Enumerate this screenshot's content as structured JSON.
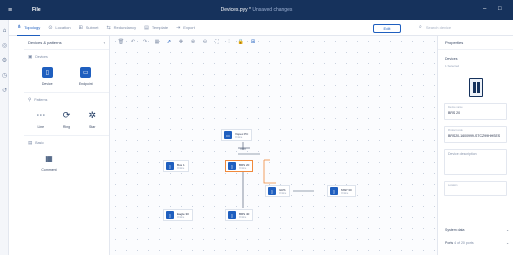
{
  "titlebar": {
    "file_label": "File",
    "doc_name": "Devices.pyy *",
    "doc_status": "Unsaved changes",
    "minimize": "–",
    "maximize": "□"
  },
  "tabs": [
    {
      "label": "Topology",
      "icon": "topology-icon"
    },
    {
      "label": "Location",
      "icon": "location-icon"
    },
    {
      "label": "Subnet",
      "icon": "subnet-icon"
    },
    {
      "label": "Redundancy",
      "icon": "redundancy-icon"
    },
    {
      "label": "Template",
      "icon": "template-icon"
    },
    {
      "label": "Export",
      "icon": "export-icon"
    }
  ],
  "edit_label": "Edit",
  "search_placeholder": "Search device",
  "library": {
    "title": "Devices & patterns",
    "collapse": "‹",
    "sections": [
      {
        "title": "Devices",
        "items": [
          {
            "label": "Device"
          },
          {
            "label": "Endpoint"
          }
        ]
      },
      {
        "title": "Patterns",
        "items": [
          {
            "label": "Line"
          },
          {
            "label": "Ring"
          },
          {
            "label": "Star"
          }
        ]
      },
      {
        "title": "Basic",
        "items": [
          {
            "label": "Comment"
          }
        ]
      }
    ]
  },
  "nodes": [
    {
      "id": "n1",
      "name": "Vspec PC",
      "sub": "Online"
    },
    {
      "id": "n2",
      "name": "Bus 1",
      "sub": "Online"
    },
    {
      "id": "n3",
      "name": "BRS 20",
      "sub": "Online"
    },
    {
      "id": "n4",
      "name": "GRS",
      "sub": "Online"
    },
    {
      "id": "n5",
      "name": "MSP 30",
      "sub": "Online"
    },
    {
      "id": "n6",
      "name": "Eagle 30",
      "sub": "Online"
    },
    {
      "id": "n7",
      "name": "BRS 40",
      "sub": "Online"
    }
  ],
  "properties": {
    "title": "Properties",
    "section": "Devices",
    "count": "1 Selected",
    "fields": {
      "name_label": "Device name",
      "name_value": "BRS 20",
      "product_label": "Product code",
      "product_value": "BRS20-1600999-STCZ99HHSES",
      "description_placeholder": "Device description",
      "location_label": "Location"
    },
    "system_data": "System data",
    "ports": "Ports",
    "ports_value": "4 of 20 ports"
  },
  "colors": {
    "primary": "#1f5fbf",
    "titlebar": "#16325c",
    "selection": "#f08a3c"
  }
}
